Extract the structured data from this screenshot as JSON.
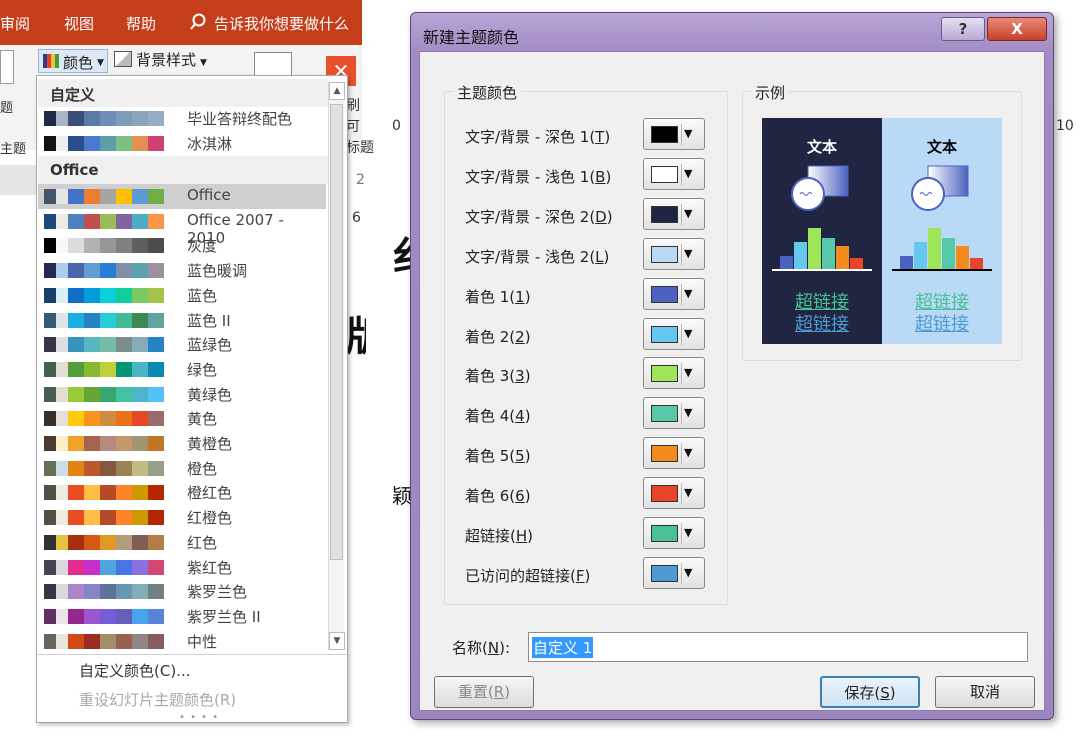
{
  "ribbon": {
    "tabs": [
      "审阅",
      "视图",
      "帮助"
    ],
    "search_text": "告诉我你想要做什么",
    "color_button": "颜色",
    "background_style_button": "背景样式",
    "left_group_labels": [
      "题",
      "主题"
    ]
  },
  "background_fragments": [
    "刷",
    "可",
    "标题",
    "i",
    "2",
    "6",
    "0",
    "10"
  ],
  "background_big_glyphs": [
    "纟",
    "版",
    "颖"
  ],
  "dropdown": {
    "custom_header": "自定义",
    "custom_items": [
      {
        "name": "毕业答辩终配色",
        "colors": [
          "#1f2a44",
          "#aab4c4",
          "#3a4e78",
          "#5a7aa8",
          "#6e8fb8",
          "#7f9cb8",
          "#8aa6bf",
          "#96aec4"
        ]
      },
      {
        "name": "冰淇淋",
        "colors": [
          "#111111",
          "#eeeeee",
          "#2a4e8c",
          "#4a7ad0",
          "#5aa0a8",
          "#7ec080",
          "#e09050",
          "#d04070"
        ]
      }
    ],
    "office_header": "Office",
    "office_items": [
      {
        "name": "Office",
        "colors": [
          "#44546a",
          "#e7e6e6",
          "#4472c4",
          "#ed7d31",
          "#a5a5a5",
          "#ffc000",
          "#5b9bd5",
          "#70ad47"
        ]
      },
      {
        "name": "Office 2007 - 2010",
        "colors": [
          "#1f497d",
          "#eeece1",
          "#4f81bd",
          "#c0504d",
          "#9bbb59",
          "#8064a2",
          "#4bacc6",
          "#f79646"
        ]
      },
      {
        "name": "灰度",
        "colors": [
          "#000000",
          "#f8f8f8",
          "#dddddd",
          "#b2b2b2",
          "#969696",
          "#808080",
          "#5f5f5f",
          "#4d4d4d"
        ]
      },
      {
        "name": "蓝色暖调",
        "colors": [
          "#242852",
          "#acccea",
          "#4a66ac",
          "#629dd1",
          "#297fd5",
          "#7f8fa9",
          "#5aa2ae",
          "#9d90a0"
        ]
      },
      {
        "name": "蓝色",
        "colors": [
          "#17406d",
          "#dbeff9",
          "#0f6fc6",
          "#009dd9",
          "#0bd0d9",
          "#10cf9b",
          "#7cca62",
          "#a5c249"
        ]
      },
      {
        "name": "蓝色 II",
        "colors": [
          "#335b74",
          "#dfe3e5",
          "#1cade4",
          "#2683c6",
          "#27ced7",
          "#42ba97",
          "#3e8853",
          "#62a39f"
        ]
      },
      {
        "name": "蓝绿色",
        "colors": [
          "#373545",
          "#dedee2",
          "#3494ba",
          "#58b6c0",
          "#75bda7",
          "#7a8c8e",
          "#84acb6",
          "#2683c6"
        ]
      },
      {
        "name": "绿色",
        "colors": [
          "#455f51",
          "#e3ded1",
          "#549e39",
          "#8ab833",
          "#c0cf3a",
          "#029676",
          "#4ab5c4",
          "#0989b1"
        ]
      },
      {
        "name": "黄绿色",
        "colors": [
          "#455f51",
          "#e3ded1",
          "#99cb38",
          "#63a537",
          "#37a76f",
          "#44c1a3",
          "#4eb3cf",
          "#51c3f9"
        ]
      },
      {
        "name": "黄色",
        "colors": [
          "#39302a",
          "#e5dedb",
          "#ffca08",
          "#f8931d",
          "#ce8d3e",
          "#ec7016",
          "#e64823",
          "#9c6a6a"
        ]
      },
      {
        "name": "黄橙色",
        "colors": [
          "#4e3b30",
          "#fbeec9",
          "#f0a22e",
          "#a5644e",
          "#b58b80",
          "#c3986d",
          "#a19574",
          "#c17529"
        ]
      },
      {
        "name": "橙色",
        "colors": [
          "#637052",
          "#ccddea",
          "#e48312",
          "#bd582c",
          "#865640",
          "#9b8357",
          "#c2bc80",
          "#94a088"
        ]
      },
      {
        "name": "橙红色",
        "colors": [
          "#505046",
          "#eeece1",
          "#e84c22",
          "#ffbd47",
          "#b64926",
          "#ff8427",
          "#cc9900",
          "#b22600"
        ]
      },
      {
        "name": "红橙色",
        "colors": [
          "#505046",
          "#eeece1",
          "#e84c22",
          "#ffbd47",
          "#b64926",
          "#ff8427",
          "#cc9900",
          "#b22600"
        ]
      },
      {
        "name": "红色",
        "colors": [
          "#323232",
          "#e5c243",
          "#a5300f",
          "#d55816",
          "#e19825",
          "#b19c7d",
          "#7f5f52",
          "#b27d49"
        ]
      },
      {
        "name": "紫红色",
        "colors": [
          "#454551",
          "#d8d9dc",
          "#e32d91",
          "#c830cc",
          "#4ea6dc",
          "#4775e7",
          "#8971e1",
          "#d54773"
        ]
      },
      {
        "name": "紫罗兰色",
        "colors": [
          "#373545",
          "#dcd8dc",
          "#ad84c6",
          "#8784c7",
          "#5d739a",
          "#6997af",
          "#84acb6",
          "#6f8183"
        ]
      },
      {
        "name": "紫罗兰色 II",
        "colors": [
          "#632e62",
          "#eae5eb",
          "#92278f",
          "#9b57d3",
          "#755dd9",
          "#665eb8",
          "#45a5ed",
          "#5982db"
        ]
      },
      {
        "name": "中性",
        "colors": [
          "#696464",
          "#e9e5dc",
          "#d34817",
          "#9b2d1f",
          "#a28e6a",
          "#956251",
          "#918485",
          "#855d5d"
        ]
      }
    ],
    "footer_custom": "自定义颜色(C)...",
    "footer_reset": "重设幻灯片主题颜色(R)"
  },
  "dialog": {
    "title": "新建主题颜色",
    "help_glyph": "?",
    "close_glyph": "X",
    "theme_colors_label": "主题颜色",
    "rows": [
      {
        "label": "文字/背景 - 深色 1(",
        "key": "T",
        "color": "#000000"
      },
      {
        "label": "文字/背景 - 浅色 1(",
        "key": "B",
        "color": "#ffffff"
      },
      {
        "label": "文字/背景 - 深色 2(",
        "key": "D",
        "color": "#202542"
      },
      {
        "label": "文字/背景 - 浅色 2(",
        "key": "L",
        "color": "#b9d9f7"
      },
      {
        "label": "着色 1(",
        "key": "1",
        "color": "#4b62c0"
      },
      {
        "label": "着色 2(",
        "key": "2",
        "color": "#66c7ef"
      },
      {
        "label": "着色 3(",
        "key": "3",
        "color": "#9ee55a"
      },
      {
        "label": "着色 4(",
        "key": "4",
        "color": "#58c9a8"
      },
      {
        "label": "着色 5(",
        "key": "5",
        "color": "#f58a1f"
      },
      {
        "label": "着色 6(",
        "key": "6",
        "color": "#e9432a"
      },
      {
        "label": "超链接(",
        "key": "H",
        "color": "#49c195"
      },
      {
        "label": "已访问的超链接(",
        "key": "F",
        "color": "#4e9ad3"
      }
    ],
    "sample_label": "示例",
    "sample_text": "文本",
    "sample_link": "超链接",
    "name_label": "名称(",
    "name_key": "N",
    "name_value": "自定义 1",
    "reset_label": "重置(",
    "reset_key": "R",
    "save_label": "保存(",
    "save_key": "S",
    "cancel_label": "取消"
  }
}
